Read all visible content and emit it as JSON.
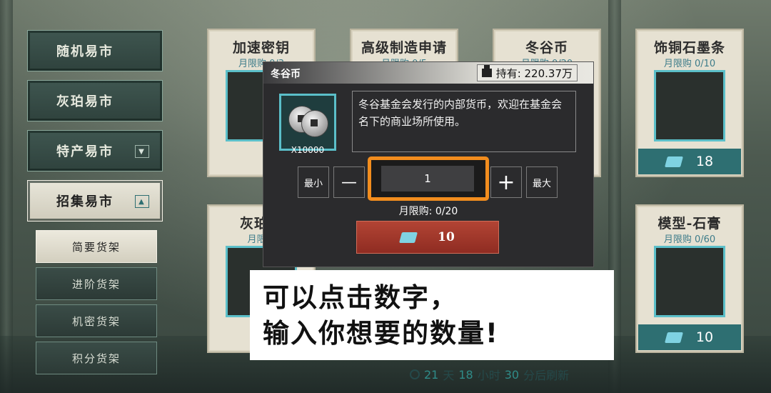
{
  "sidebar": {
    "items": [
      {
        "label": "随机易市"
      },
      {
        "label": "灰珀易市"
      },
      {
        "label": "特产易市",
        "indicator": "▼"
      },
      {
        "label": "招集易市",
        "indicator": "▲"
      }
    ],
    "subitems": [
      {
        "label": "简要货架"
      },
      {
        "label": "进阶货架"
      },
      {
        "label": "机密货架"
      },
      {
        "label": "积分货架"
      }
    ]
  },
  "cards": [
    {
      "name": "加速密钥",
      "limit": "月限购 0/3"
    },
    {
      "name": "高级制造申请",
      "limit": "月限购 0/5"
    },
    {
      "name": "冬谷币",
      "limit": "月限购 0/20"
    },
    {
      "name": "饰铜石墨条",
      "limit": "月限购 0/10",
      "price": "18"
    },
    {
      "name": "灰珀碎",
      "limit": "月限购"
    },
    {
      "name": "模型-石膏",
      "limit": "月限购 0/60",
      "price": "10"
    }
  ],
  "popup": {
    "title": "冬谷币",
    "holding": "持有: 220.37万",
    "item_qty": "X10000",
    "description": "冬谷基金会发行的内部货币，欢迎在基金会名下的商业场所使用。",
    "min_label": "最小",
    "minus_label": "—",
    "quantity": "1",
    "plus_label": "+",
    "max_label": "最大",
    "monthly_limit": "月限购: 0/20",
    "price": "10"
  },
  "annotation": {
    "line1": "可以点击数字，",
    "line2": "输入你想要的数量!"
  },
  "refresh": {
    "days": "21",
    "days_unit": "天",
    "hours": "18",
    "hours_unit": "小时",
    "minutes": "30",
    "minutes_unit": "分后刷新"
  }
}
